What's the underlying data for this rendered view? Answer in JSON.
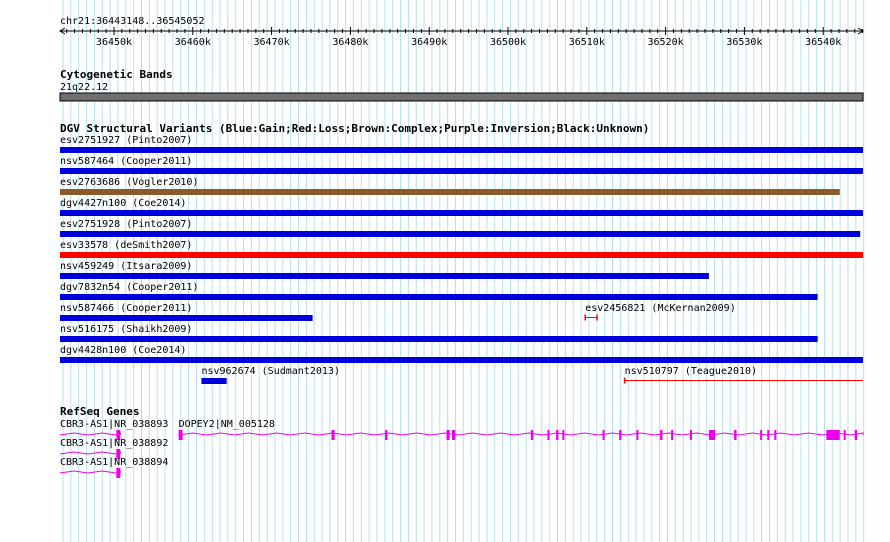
{
  "region_label": "chr21:36443148..36545052",
  "ruler": {
    "ticks": [
      {
        "label": "36450k",
        "pos": 36450000
      },
      {
        "label": "36460k",
        "pos": 36460000
      },
      {
        "label": "36470k",
        "pos": 36470000
      },
      {
        "label": "36480k",
        "pos": 36480000
      },
      {
        "label": "36490k",
        "pos": 36490000
      },
      {
        "label": "36500k",
        "pos": 36500000
      },
      {
        "label": "36510k",
        "pos": 36510000
      },
      {
        "label": "36520k",
        "pos": 36520000
      },
      {
        "label": "36530k",
        "pos": 36530000
      },
      {
        "label": "36540k",
        "pos": 36540000
      }
    ]
  },
  "tracks": {
    "cytoband": {
      "title": "Cytogenetic Bands",
      "band": "21q22.12",
      "color": "#707070"
    },
    "dgv": {
      "title": "DGV Structural Variants (Blue:Gain;Red:Loss;Brown:Complex;Purple:Inversion;Black:Unknown)",
      "colors": {
        "gain": "#0000dd",
        "loss": "#ff0000",
        "complex": "#8b5a2b"
      },
      "variants": [
        {
          "label": "esv2751927 (Pinto2007)",
          "type": "gain",
          "start": 36443148,
          "end": 36545052,
          "row": 0
        },
        {
          "label": "nsv587464 (Cooper2011)",
          "type": "gain",
          "start": 36443148,
          "end": 36545052,
          "row": 1
        },
        {
          "label": "esv2763686 (Vogler2010)",
          "type": "complex",
          "start": 36443148,
          "end": 36542100,
          "row": 2
        },
        {
          "label": "dgv4427n100 (Coe2014)",
          "type": "gain",
          "start": 36443148,
          "end": 36545052,
          "row": 3
        },
        {
          "label": "esv2751928 (Pinto2007)",
          "type": "gain",
          "start": 36443148,
          "end": 36544700,
          "row": 4
        },
        {
          "label": "esv33578 (deSmith2007)",
          "type": "loss",
          "start": 36443148,
          "end": 36545052,
          "row": 5
        },
        {
          "label": "nsv459249 (Itsara2009)",
          "type": "gain",
          "start": 36443148,
          "end": 36525500,
          "row": 6
        },
        {
          "label": "dgv7832n54 (Cooper2011)",
          "type": "gain",
          "start": 36443148,
          "end": 36539300,
          "row": 7
        },
        {
          "label": "nsv587466 (Cooper2011)",
          "type": "gain",
          "start": 36443148,
          "end": 36475200,
          "row": 8
        },
        {
          "label": "esv2456821 (McKernan2009)",
          "type": "loss",
          "start": 36509800,
          "end": 36511300,
          "row": 8,
          "thin": true
        },
        {
          "label": "nsv516175 (Shaikh2009)",
          "type": "gain",
          "start": 36443148,
          "end": 36539300,
          "row": 9
        },
        {
          "label": "dgv4428n100 (Coe2014)",
          "type": "gain",
          "start": 36443148,
          "end": 36545052,
          "row": 10
        },
        {
          "label": "nsv962674 (Sudmant2013)",
          "type": "gain",
          "start": 36461100,
          "end": 36464300,
          "row": 11
        },
        {
          "label": "nsv510797 (Teague2010)",
          "type": "loss",
          "start": 36514800,
          "end": 36545052,
          "row": 11,
          "thin": true,
          "open_right": true
        }
      ]
    },
    "refseq": {
      "title": "RefSeq Genes",
      "color": "#ee00ee",
      "genes": [
        {
          "label": "CBR3-AS1|NR_038893",
          "row": 0,
          "start": 36443148,
          "end": 36450800,
          "exons": [
            [
              36450300,
              36450800
            ]
          ]
        },
        {
          "label": "DOPEY2|NM_005128",
          "row": 0,
          "start": 36458200,
          "end": 36545052,
          "exons": [
            [
              36458200,
              36458700
            ],
            [
              36477600,
              36478000
            ],
            [
              36484400,
              36484700
            ],
            [
              36492200,
              36492600
            ],
            [
              36492900,
              36493300
            ],
            [
              36502900,
              36503200
            ],
            [
              36505000,
              36505200
            ],
            [
              36506100,
              36506400
            ],
            [
              36506900,
              36507100
            ],
            [
              36512000,
              36512200
            ],
            [
              36514100,
              36514400
            ],
            [
              36516300,
              36516500
            ],
            [
              36519300,
              36519600
            ],
            [
              36520700,
              36520900
            ],
            [
              36523100,
              36523300
            ],
            [
              36525500,
              36526300
            ],
            [
              36528700,
              36529000
            ],
            [
              36532000,
              36532200
            ],
            [
              36532900,
              36533100
            ],
            [
              36533800,
              36534000
            ],
            [
              36540400,
              36542100
            ],
            [
              36542600,
              36542800
            ],
            [
              36544000,
              36544300
            ]
          ]
        },
        {
          "label": "CBR3-AS1|NR_038892",
          "row": 1,
          "start": 36443148,
          "end": 36450800,
          "exons": [
            [
              36450300,
              36450800
            ]
          ]
        },
        {
          "label": "CBR3-AS1|NR_038894",
          "row": 2,
          "start": 36443148,
          "end": 36450800,
          "exons": [
            [
              36450300,
              36450800
            ]
          ]
        }
      ]
    }
  }
}
